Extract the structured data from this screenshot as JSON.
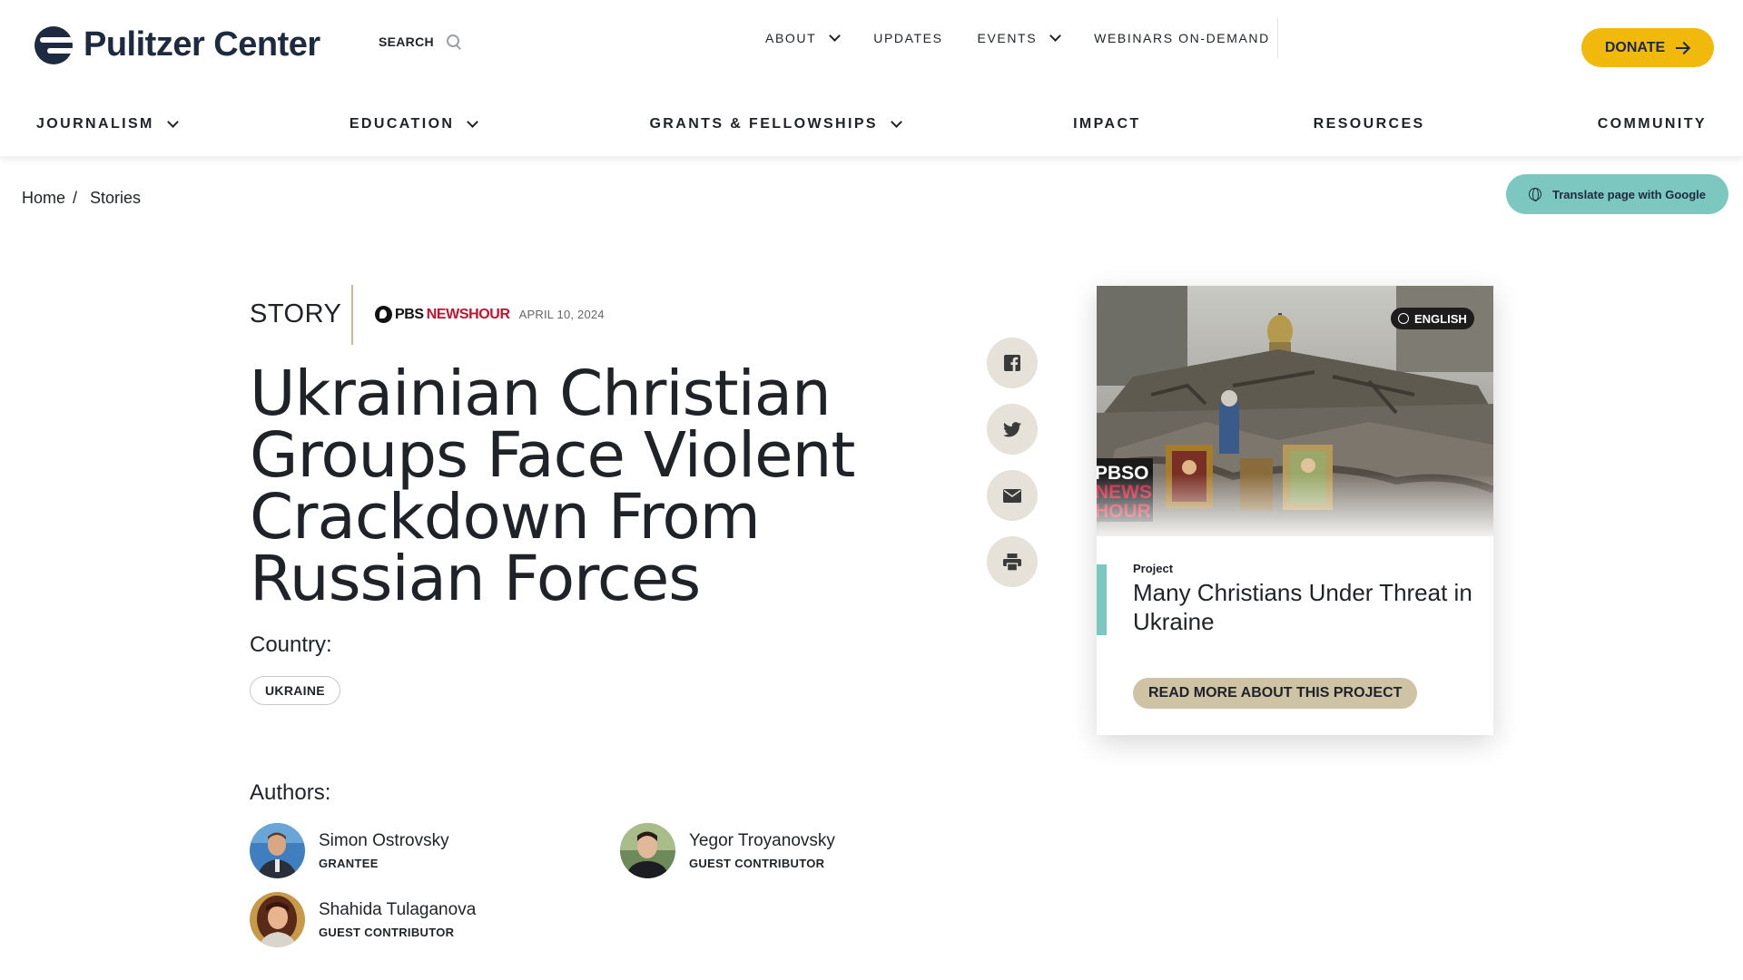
{
  "header": {
    "logo_text": "Pulitzer Center",
    "search_label": "SEARCH",
    "top_nav": [
      {
        "label": "ABOUT",
        "has_dropdown": true
      },
      {
        "label": "UPDATES",
        "has_dropdown": false
      },
      {
        "label": "EVENTS",
        "has_dropdown": true
      },
      {
        "label": "WEBINARS ON-DEMAND",
        "has_dropdown": false
      }
    ],
    "donate_label": "DONATE",
    "main_nav": [
      {
        "label": "JOURNALISM",
        "has_dropdown": true
      },
      {
        "label": "EDUCATION",
        "has_dropdown": true
      },
      {
        "label": "GRANTS & FELLOWSHIPS",
        "has_dropdown": true
      },
      {
        "label": "IMPACT",
        "has_dropdown": false
      },
      {
        "label": "RESOURCES",
        "has_dropdown": false
      },
      {
        "label": "COMMUNITY",
        "has_dropdown": false
      }
    ]
  },
  "breadcrumb": {
    "home": "Home",
    "separator": "/",
    "current": "Stories"
  },
  "translate_label": "Translate page with Google",
  "article": {
    "type": "STORY",
    "source_pbs": "PBS",
    "source_newshour": "NEWSHOUR",
    "date": "APRIL 10, 2024",
    "title": "Ukrainian Christian Groups Face Violent Crackdown From Russian Forces",
    "country_label": "Country:",
    "country_tag": "UKRAINE",
    "authors_label": "Authors:",
    "authors": [
      {
        "name": "Simon Ostrovsky",
        "role": "GRANTEE"
      },
      {
        "name": "Yegor Troyanovsky",
        "role": "GUEST CONTRIBUTOR"
      },
      {
        "name": "Shahida Tulaganova",
        "role": "GUEST CONTRIBUTOR"
      }
    ]
  },
  "share": [
    "facebook-icon",
    "twitter-icon",
    "email-icon",
    "print-icon"
  ],
  "project_card": {
    "language": "ENGLISH",
    "image_overlay": "PBS NEWS HOUR",
    "kicker": "Project",
    "title": "Many Christians Under Threat in Ukraine",
    "button_label": "READ MORE ABOUT THIS PROJECT"
  },
  "colors": {
    "brand_navy": "#1d2a3f",
    "donate_yellow": "#f0b90b",
    "accent_teal": "#7cc8c0",
    "tan_button": "#cfc3a6",
    "newshour_red": "#c8102e"
  }
}
